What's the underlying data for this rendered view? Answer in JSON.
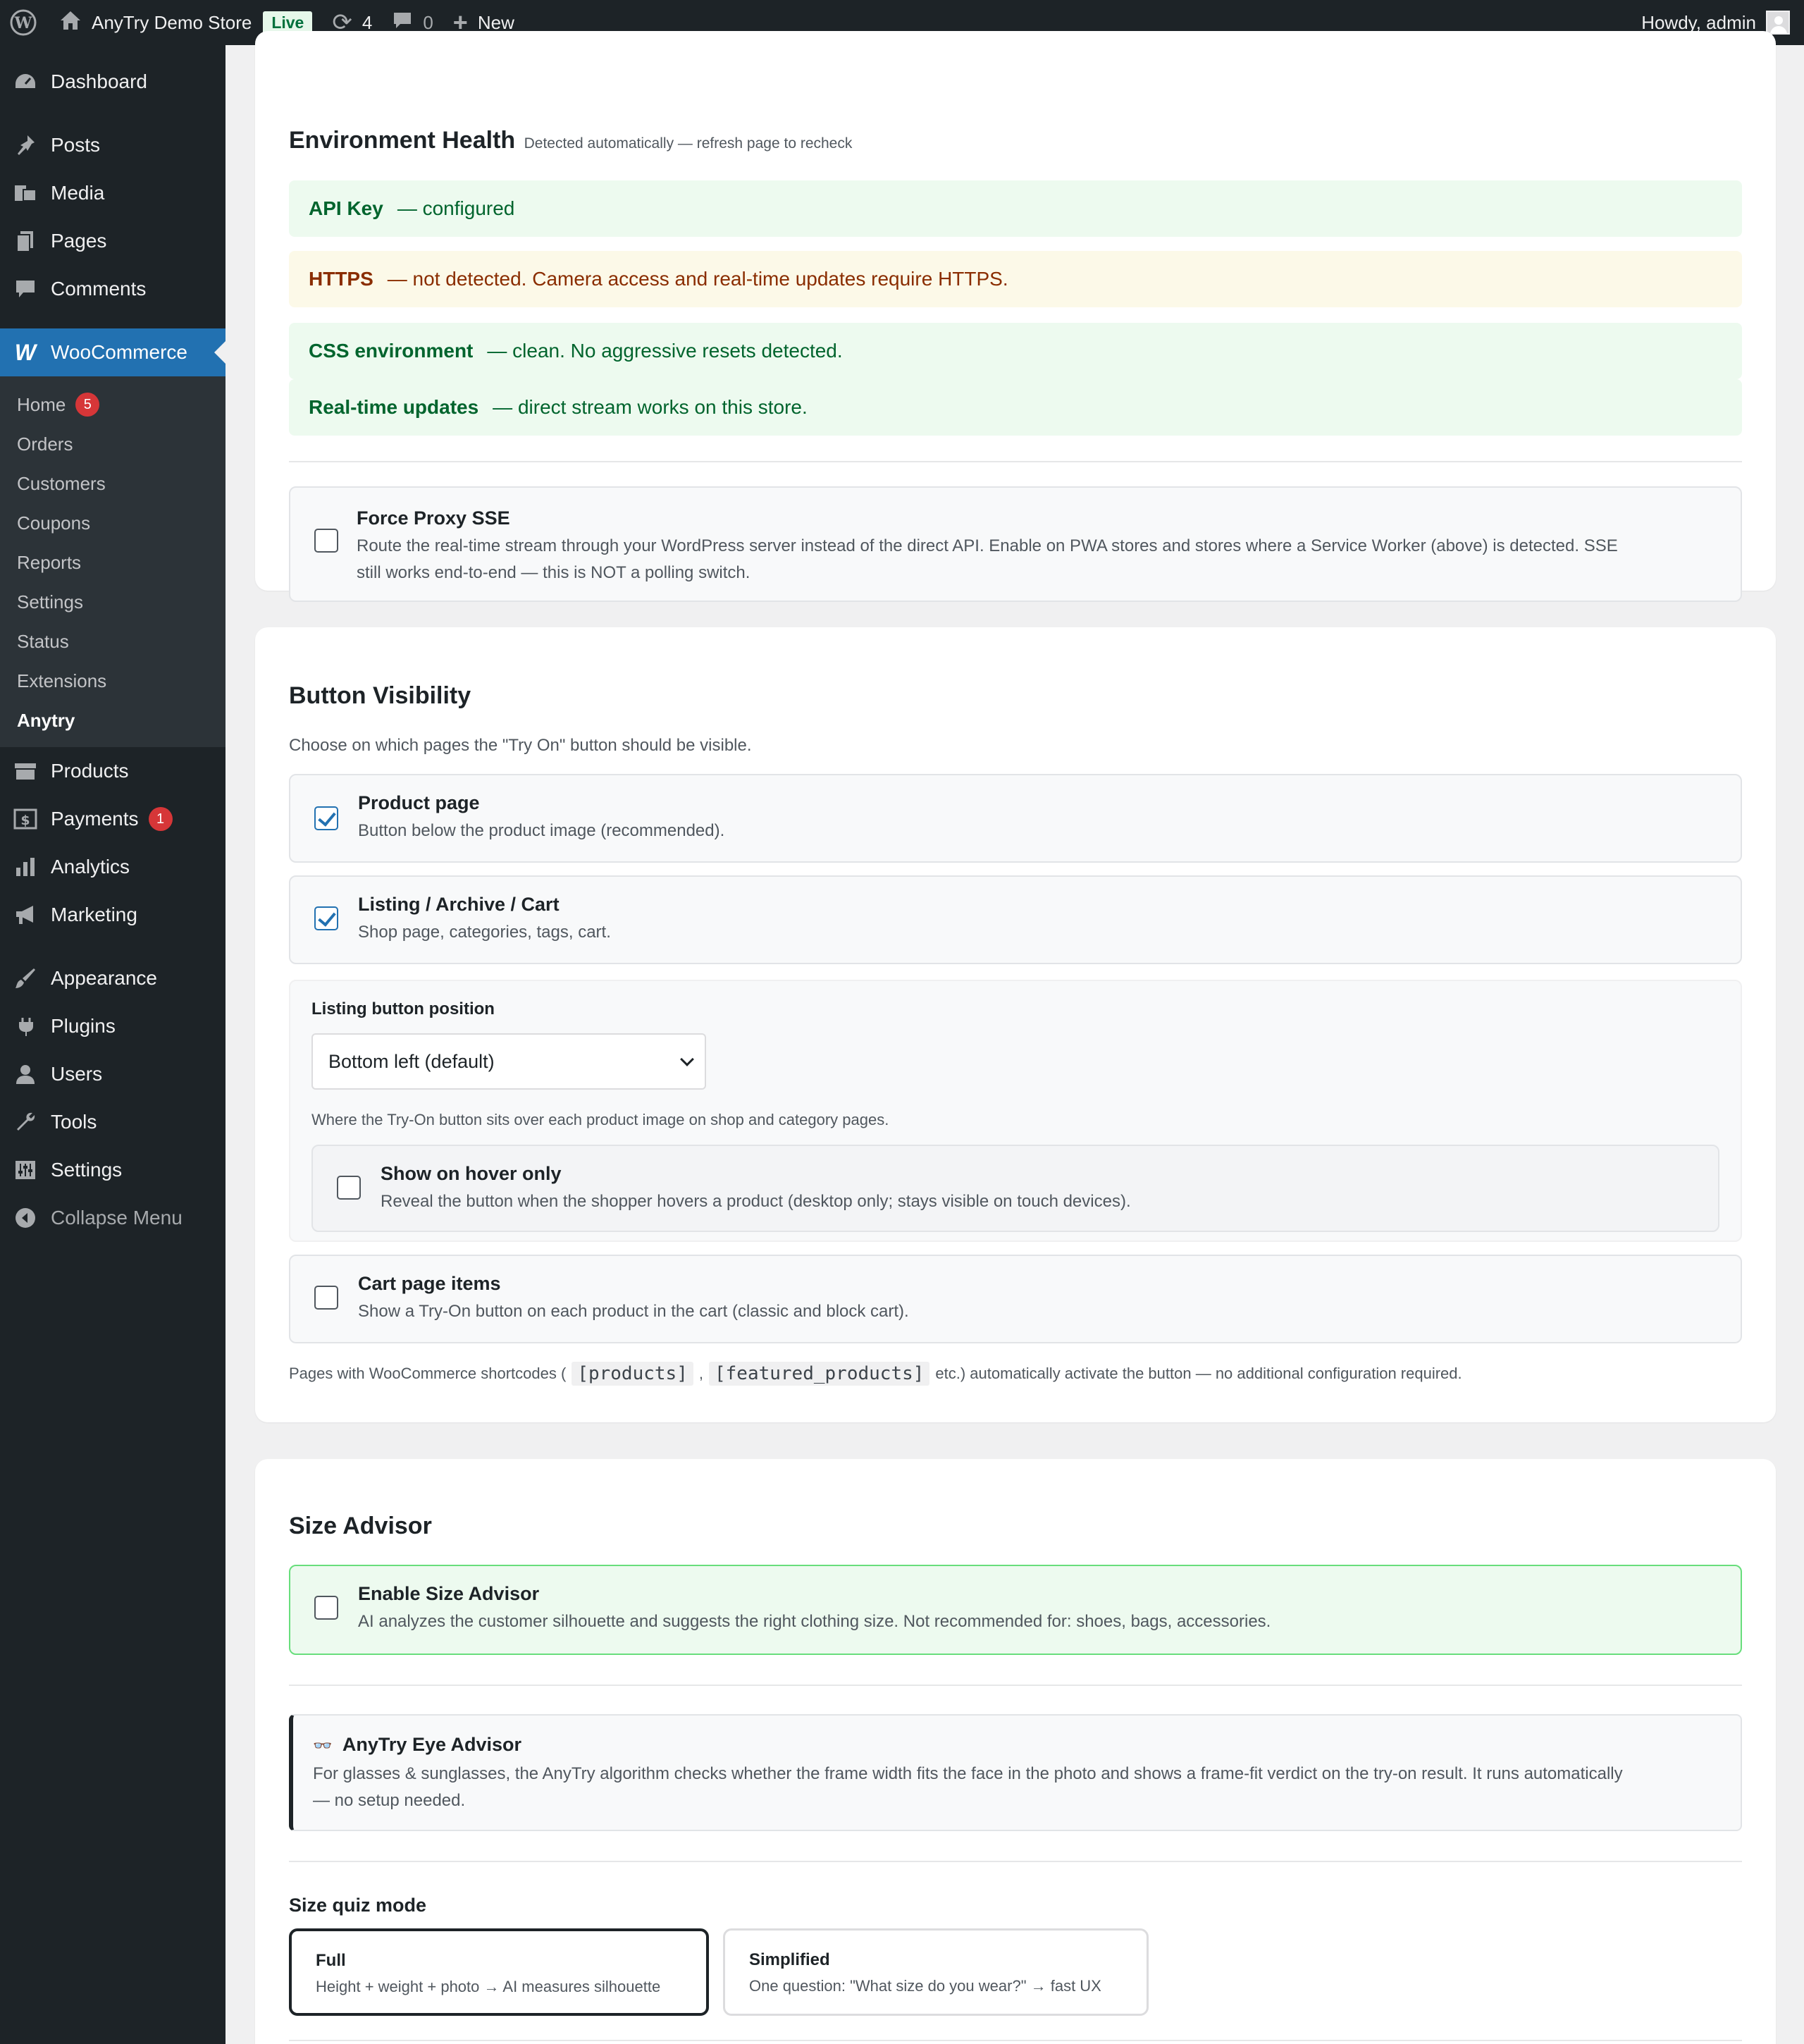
{
  "admin_bar": {
    "site_name": "AnyTry Demo Store",
    "live_badge": "Live",
    "updates_count": "4",
    "comments_count": "0",
    "new_label": "New",
    "howdy": "Howdy, admin"
  },
  "sidebar": {
    "dashboard": "Dashboard",
    "posts": "Posts",
    "media": "Media",
    "pages": "Pages",
    "comments": "Comments",
    "woocommerce": "WooCommerce",
    "woo_sub": {
      "home": "Home",
      "home_badge": "5",
      "orders": "Orders",
      "customers": "Customers",
      "coupons": "Coupons",
      "reports": "Reports",
      "settings": "Settings",
      "status": "Status",
      "extensions": "Extensions",
      "anytry": "Anytry"
    },
    "products": "Products",
    "payments": "Payments",
    "payments_badge": "1",
    "analytics": "Analytics",
    "marketing": "Marketing",
    "appearance": "Appearance",
    "plugins": "Plugins",
    "users": "Users",
    "tools": "Tools",
    "settings": "Settings",
    "collapse": "Collapse Menu"
  },
  "env_health": {
    "title": "Environment Health",
    "subtitle": "Detected automatically — refresh page to recheck",
    "rows": [
      {
        "label": "API Key",
        "text": "— configured",
        "status": "ok"
      },
      {
        "label": "HTTPS",
        "text": "— not detected. Camera access and real-time updates require HTTPS.",
        "status": "warn"
      },
      {
        "label": "CSS environment",
        "text": "— clean. No aggressive resets detected.",
        "status": "ok"
      },
      {
        "label": "Real-time updates",
        "text": "— direct stream works on this store.",
        "status": "ok"
      }
    ],
    "force_proxy": {
      "title": "Force Proxy SSE",
      "desc_line1": "Route the real-time stream through your WordPress server instead of the direct API. Enable on PWA stores and stores where a Service Worker (above) is detected. SSE",
      "desc_line2": "still works end-to-end — this is NOT a polling switch.",
      "checked": false
    }
  },
  "button_visibility": {
    "title": "Button Visibility",
    "intro": "Choose on which pages the \"Try On\" button should be visible.",
    "product_page": {
      "title": "Product page",
      "desc": "Button below the product image (recommended).",
      "checked": true
    },
    "listing": {
      "title": "Listing / Archive / Cart",
      "desc": "Shop page, categories, tags, cart.",
      "checked": true
    },
    "position_label": "Listing button position",
    "position_value": "Bottom left (default)",
    "position_help": "Where the Try-On button sits over each product image on shop and category pages.",
    "hover_only": {
      "title": "Show on hover only",
      "desc": "Reveal the button when the shopper hovers a product (desktop only; stays visible on touch devices).",
      "checked": false
    },
    "cart_items": {
      "title": "Cart page items",
      "desc": "Show a Try-On button on each product in the cart (classic and block cart).",
      "checked": false
    },
    "shortcodes_prefix": "Pages with WooCommerce shortcodes (",
    "shortcode_1": "[products]",
    "shortcode_sep": ",",
    "shortcode_2": "[featured_products]",
    "shortcodes_suffix": "etc.) automatically activate the button — no additional configuration required."
  },
  "size_advisor": {
    "title": "Size Advisor",
    "enable": {
      "title": "Enable Size Advisor",
      "desc": "AI analyzes the customer silhouette and suggests the right clothing size. Not recommended for: shoes, bags, accessories.",
      "checked": false
    },
    "eye_advisor": {
      "icon": "👓",
      "title": "AnyTry Eye Advisor",
      "desc_line1": "For glasses & sunglasses, the AnyTry algorithm checks whether the frame width fits the face in the photo and shows a frame-fit verdict on the try-on result. It runs automatically",
      "desc_line2": "— no setup needed."
    },
    "quiz_label": "Size quiz mode",
    "modes": [
      {
        "title": "Full",
        "desc": "Height + weight + photo → AI measures silhouette",
        "selected": true
      },
      {
        "title": "Simplified",
        "desc": "One question: \"What size do you wear?\" → fast UX",
        "selected": false
      }
    ]
  },
  "colors": {
    "admin_dark": "#1d2327",
    "accent_blue": "#2271b1",
    "ok_bg": "#edfaef",
    "ok_text": "#00642d",
    "warn_bg": "#fcf9e8",
    "warn_text": "#8a2d00",
    "badge_red": "#d63638"
  }
}
